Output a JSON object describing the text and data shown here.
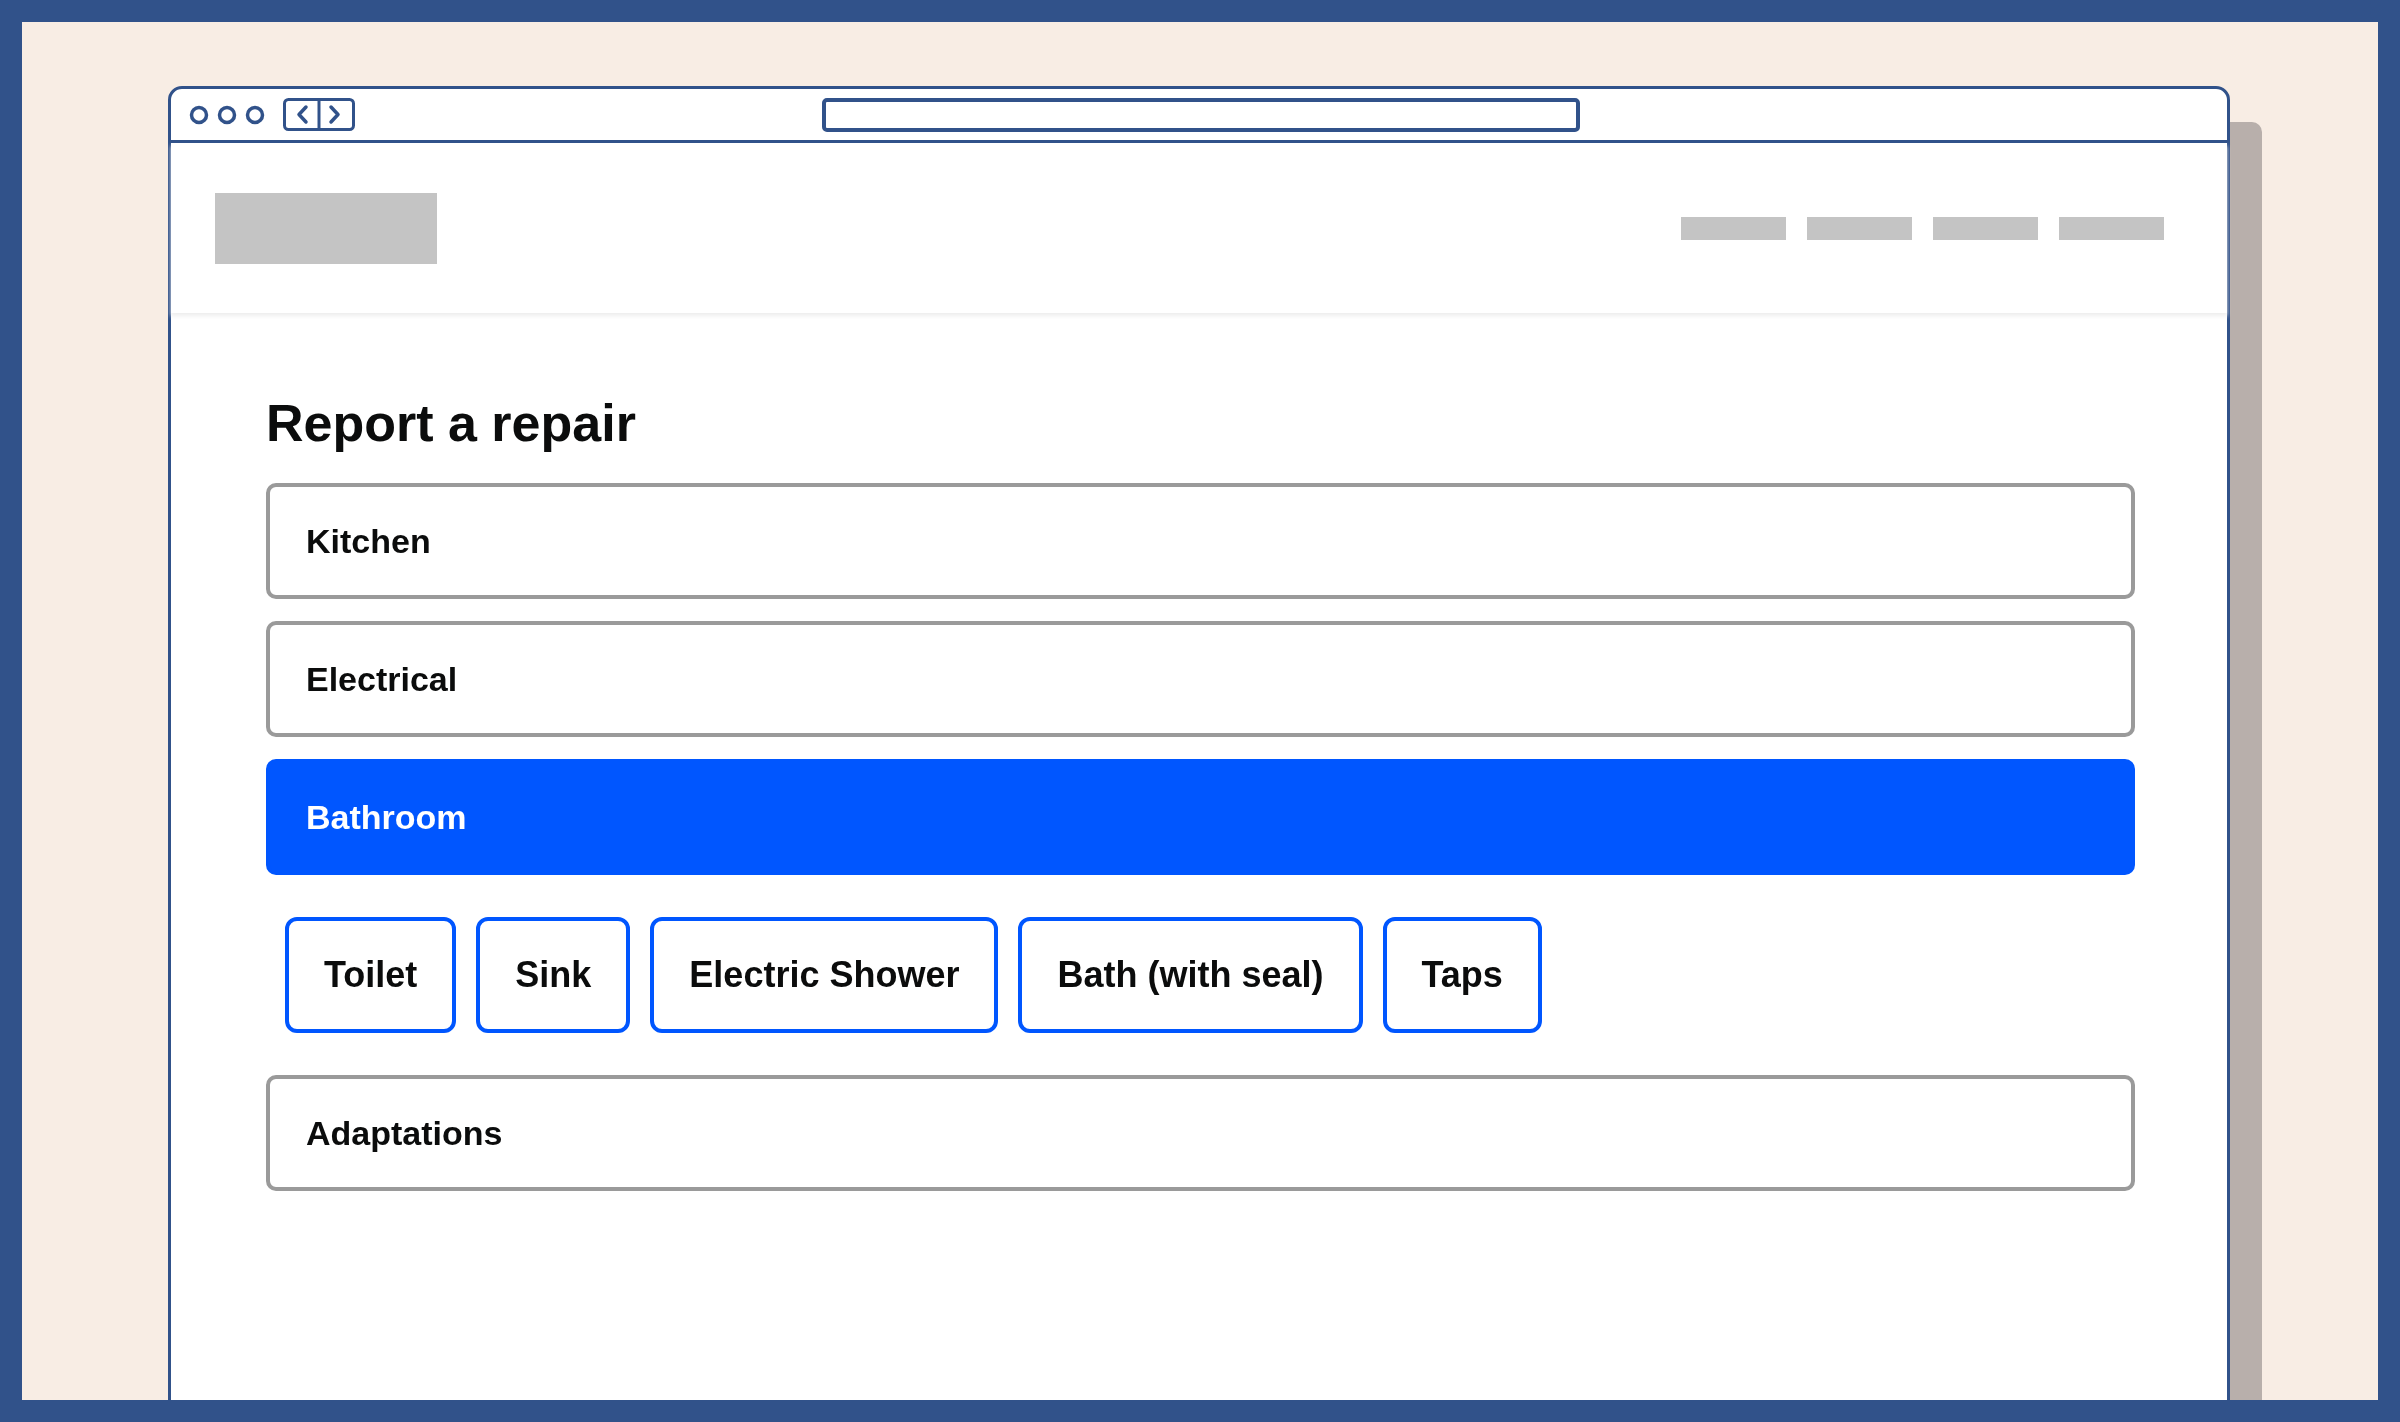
{
  "page": {
    "title": "Report a repair"
  },
  "categories": [
    {
      "label": "Kitchen",
      "selected": false
    },
    {
      "label": "Electrical",
      "selected": false
    },
    {
      "label": "Bathroom",
      "selected": true,
      "options": [
        {
          "label": "Toilet"
        },
        {
          "label": "Sink"
        },
        {
          "label": "Electric Shower"
        },
        {
          "label": "Bath (with seal)"
        },
        {
          "label": "Taps"
        }
      ]
    },
    {
      "label": "Adaptations",
      "selected": false
    }
  ]
}
